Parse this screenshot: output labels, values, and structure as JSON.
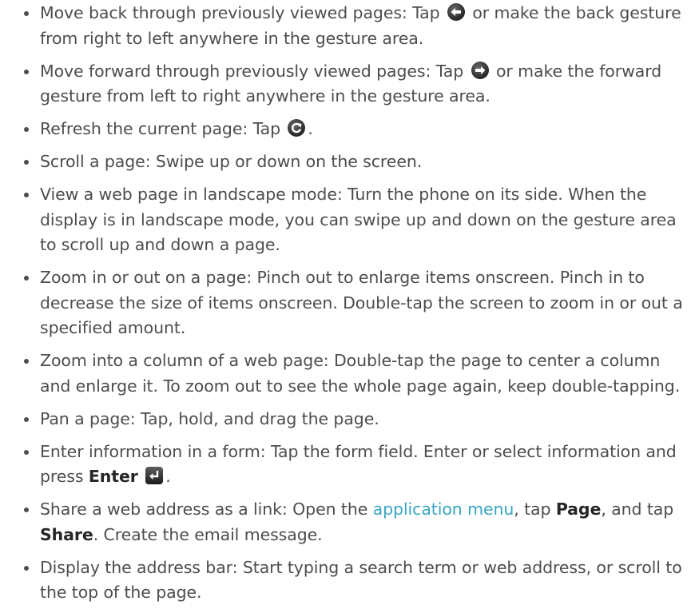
{
  "bullets": [
    {
      "before": "Move back through previously viewed pages: Tap ",
      "icon": "back-arrow-icon",
      "after": " or make the back gesture from right to left anywhere in the gesture area."
    },
    {
      "before": "Move forward through previously viewed pages: Tap ",
      "icon": "forward-arrow-icon",
      "after": " or make the forward gesture from left to right anywhere in the gesture area."
    },
    {
      "before": "Refresh the current page: Tap ",
      "icon": "refresh-icon",
      "after": "."
    },
    {
      "text": "Scroll a page: Swipe up or down on the screen."
    },
    {
      "text": "View a web page in landscape mode: Turn the phone on its side. When the display is in landscape mode, you can swipe up and down on the gesture area to scroll up and down a page."
    },
    {
      "text": "Zoom in or out on a page: Pinch out to enlarge items onscreen. Pinch in to decrease the size of items onscreen. Double-tap the screen to zoom in or out a specified amount."
    },
    {
      "text": "Zoom into a column of a web page: Double-tap the page to center a column and enlarge it. To zoom out to see the whole page again, keep double-tapping."
    },
    {
      "text": "Pan a page: Tap, hold, and drag the page."
    },
    {
      "before": "Enter information in a form: Tap the form field. Enter or select information and press ",
      "bold": "Enter",
      "icon": "enter-key-icon",
      "after": "."
    },
    {
      "before": "Share a web address as a link: Open the ",
      "link": "application menu",
      "mid1": ", tap ",
      "bold1": "Page",
      "mid2": ", and tap ",
      "bold2": "Share",
      "after": ". Create the email message."
    },
    {
      "text": "Display the address bar: Start typing a search term or web address, or scroll to the top of the page."
    }
  ],
  "colors": {
    "text": "#4d4d4d",
    "link": "#3aa6c4",
    "icon_dark": "#3c3c3c"
  }
}
